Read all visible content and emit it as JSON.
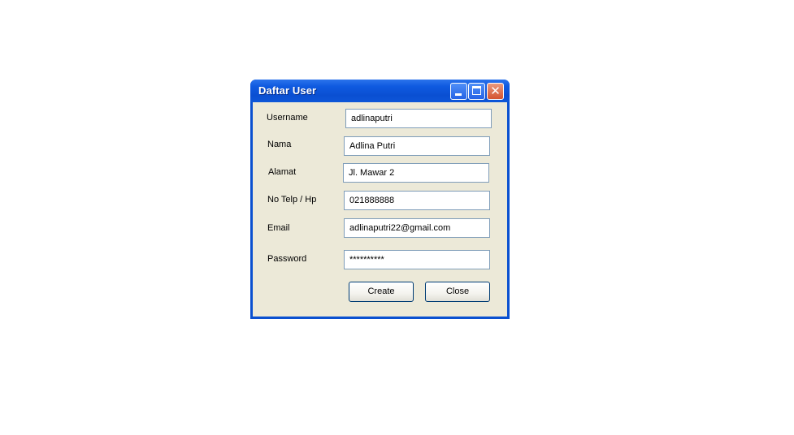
{
  "window": {
    "title": "Daftar User",
    "controls": {
      "minimize": "minimize-icon",
      "maximize": "maximize-icon",
      "close": "close-icon"
    }
  },
  "form": {
    "username": {
      "label": "Username",
      "value": "adlinaputri"
    },
    "nama": {
      "label": "Nama",
      "value": "Adlina Putri"
    },
    "alamat": {
      "label": "Alamat",
      "value": "Jl. Mawar 2"
    },
    "telp": {
      "label": "No Telp / Hp",
      "value": "021888888"
    },
    "email": {
      "label": "Email",
      "value": "adlinaputri22@gmail.com"
    },
    "password": {
      "label": "Password",
      "value": "**********"
    }
  },
  "buttons": {
    "create": "Create",
    "close": "Close"
  },
  "colors": {
    "titlebar": "#0a50d0",
    "client": "#ece9d8",
    "field_border": "#7f9db9",
    "close_button": "#d4532f"
  }
}
